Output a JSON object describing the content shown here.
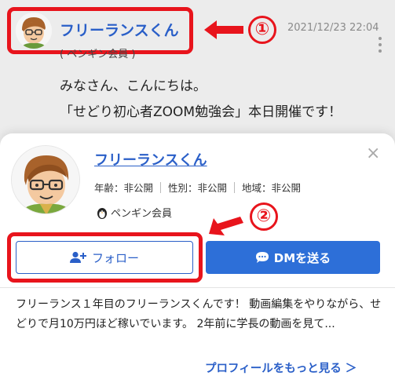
{
  "post": {
    "user_name": "フリーランスくん",
    "member_label": "( ペンギン会員 )",
    "timestamp": "2021/12/23 22:04",
    "line1": "みなさん、こんにちは。",
    "line2": "「せどり初心者ZOOM勉強会」本日開催です！"
  },
  "annotations": {
    "marker1": "①",
    "marker2": "②",
    "color": "#e8141c"
  },
  "profile_card": {
    "user_name": "フリーランスくん",
    "age": "年齢：非公開",
    "gender": "性別：非公開",
    "region": "地域：非公開",
    "member_type": "ペンギン会員",
    "follow_label": "フォロー",
    "dm_label": "DMを送る",
    "bio": "フリーランス１年目のフリーランスくんです！ 動画編集をやりながら、せどりで月10万円ほど稼いでいます。 2年前に学長の動画を見て...",
    "profile_link": "プロフィールをもっと見る ＞",
    "close_icon": "×"
  },
  "colors": {
    "link_blue": "#2a5fc8",
    "button_blue": "#2d6fd8",
    "background": "#ececec"
  },
  "icons": [
    "user-avatar-icon",
    "more-vertical-icon",
    "close-icon",
    "penguin-icon",
    "add-user-icon",
    "chat-bubble-icon",
    "arrow-left-icon"
  ]
}
